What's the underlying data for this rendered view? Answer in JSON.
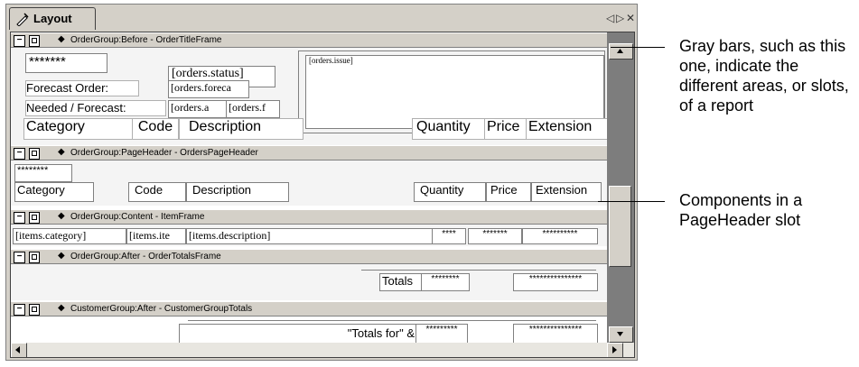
{
  "tab": {
    "label": "Layout"
  },
  "window_controls": {
    "prev": "◁",
    "next": "▷",
    "close": "✕"
  },
  "slots": {
    "before": {
      "title": "OrderGroup:Before - OrderTitleFrame",
      "fields": [
        "*******",
        "[orders.status]",
        "[orders.issue]",
        "Forecast Order:",
        "[orders.foreca",
        "Needed / Forecast:",
        "[orders.a",
        "[orders.f",
        "Category",
        "Code",
        "Description",
        "Quantity",
        "Price",
        "Extension"
      ]
    },
    "pageheader": {
      "title": "OrderGroup:PageHeader - OrdersPageHeader",
      "fields": [
        "********",
        "Category",
        "Code",
        "Description",
        "Quantity",
        "Price",
        "Extension"
      ]
    },
    "content": {
      "title": "OrderGroup:Content - ItemFrame",
      "fields": [
        "[items.category]",
        "[items.ite",
        "[items.description]",
        "****",
        "*******",
        "**********"
      ]
    },
    "after": {
      "title": "OrderGroup:After - OrderTotalsFrame",
      "fields": [
        "Totals",
        "********",
        "***************"
      ]
    },
    "customer": {
      "title": "CustomerGroup:After - CustomerGroupTotals",
      "fields": [
        "\"Totals for\" &",
        "*********",
        "***************"
      ]
    }
  },
  "callouts": {
    "gray_bars": "Gray bars, such as this one, indicate the different areas, or slots, of a report",
    "components": "Components in a PageHeader slot"
  }
}
